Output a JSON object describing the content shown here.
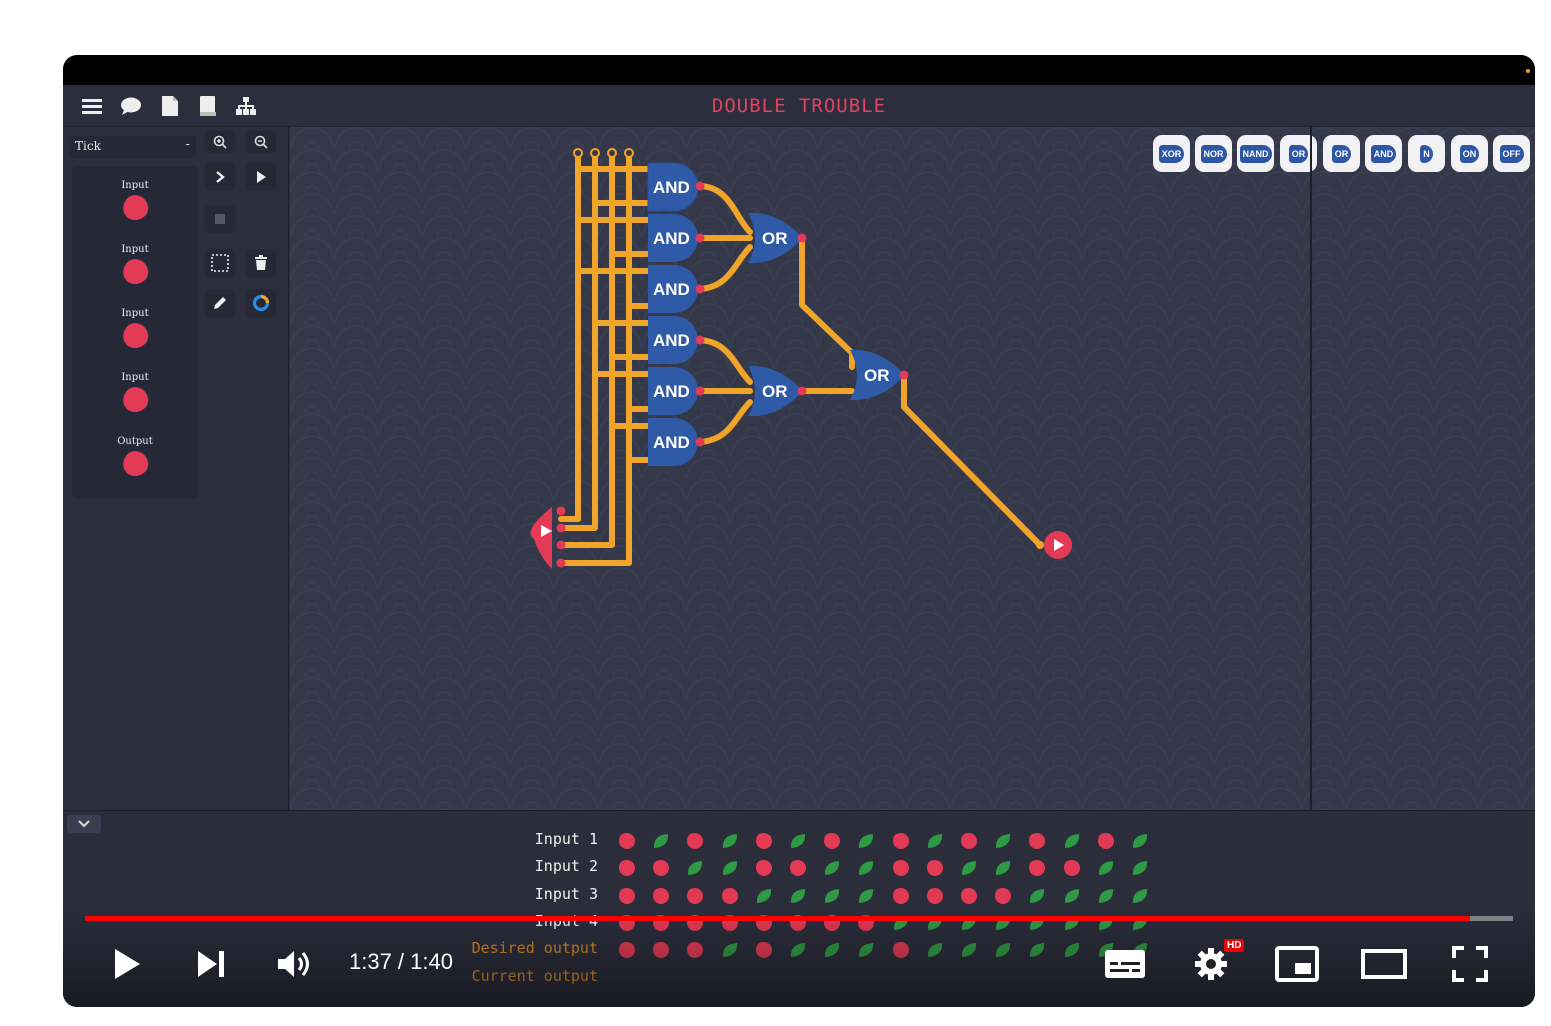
{
  "game": {
    "title": "DOUBLE TROUBLE",
    "topbar_icons": [
      "menu-icon",
      "chat-icon",
      "document-icon",
      "book-icon",
      "hierarchy-icon"
    ]
  },
  "sidebar": {
    "tick_select": "Tick",
    "tick_minus": "-",
    "io_items": [
      {
        "label": "Input"
      },
      {
        "label": "Input"
      },
      {
        "label": "Input"
      },
      {
        "label": "Input"
      },
      {
        "label": "Output"
      }
    ],
    "tools": [
      "zoom-in-icon",
      "zoom-out-icon",
      "step-icon",
      "play-icon",
      "stop-icon",
      "select-icon",
      "trash-icon",
      "pencil-icon",
      "color-wheel-icon"
    ]
  },
  "palette": [
    "XOR",
    "NOR",
    "NAND",
    "OR",
    "OR",
    "AND",
    "N",
    "ON",
    "OFF"
  ],
  "circuit": {
    "and_label": "AND",
    "or_label": "OR"
  },
  "truth_table": {
    "rows": [
      {
        "label": "Input 1",
        "values": [
          0,
          1,
          0,
          1,
          0,
          1,
          0,
          1,
          0,
          1,
          0,
          1,
          0,
          1,
          0,
          1
        ]
      },
      {
        "label": "Input 2",
        "values": [
          0,
          0,
          1,
          1,
          0,
          0,
          1,
          1,
          0,
          0,
          1,
          1,
          0,
          0,
          1,
          1
        ]
      },
      {
        "label": "Input 3",
        "values": [
          0,
          0,
          0,
          0,
          1,
          1,
          1,
          1,
          0,
          0,
          0,
          0,
          1,
          1,
          1,
          1
        ]
      },
      {
        "label": "Input 4",
        "values": [
          0,
          0,
          0,
          0,
          0,
          0,
          0,
          0,
          1,
          1,
          1,
          1,
          1,
          1,
          1,
          1
        ]
      },
      {
        "label": "Desired output",
        "values": [
          0,
          0,
          0,
          1,
          0,
          1,
          1,
          1,
          0,
          1,
          1,
          1,
          1,
          1,
          1,
          1
        ]
      },
      {
        "label": "Current output",
        "values": []
      }
    ],
    "colors": {
      "on": "#2f9a45",
      "off": "#e23a55",
      "input_label": "#f2f2f2",
      "output_label": "#d68a24"
    }
  },
  "video": {
    "time": "1:37 / 1:40",
    "progress": 0.97,
    "hd_badge": "HD",
    "accent": "#ff0000"
  }
}
